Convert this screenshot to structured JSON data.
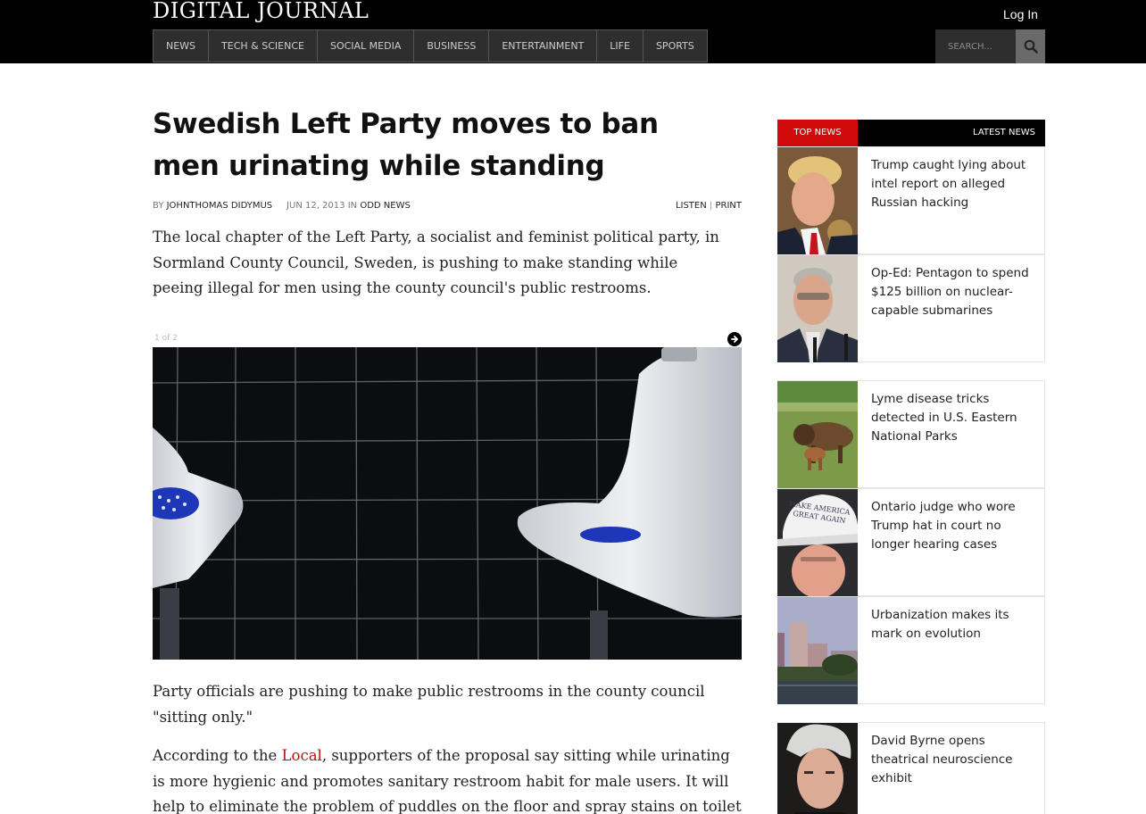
{
  "header": {
    "logo": "DIGITAL JOURNAL",
    "login": "Log In",
    "nav": [
      "NEWS",
      "TECH & SCIENCE",
      "SOCIAL MEDIA",
      "BUSINESS",
      "ENTERTAINMENT",
      "LIFE",
      "SPORTS"
    ],
    "search_placeholder": "SEARCH..."
  },
  "article": {
    "title": "Swedish Left Party moves to ban men urinating while standing",
    "by": "BY",
    "author": "JOHNTHOMAS DIDYMUS",
    "date": "JUN 12, 2013",
    "in": "IN",
    "category": "ODD NEWS",
    "listen": "LISTEN",
    "divider": "|",
    "print": "PRINT",
    "lead": "The local chapter of the Left Party, a socialist and feminist political party, in Sormland County Council, Sweden, is pushing to make standing while peeing illegal for men using the county council's public restrooms.",
    "gallery_counter": "1 of 2",
    "para2": "Party officials are pushing to make public restrooms in the county council \"sitting only.\"",
    "para3_pre": "According to the ",
    "para3_link": "Local",
    "para3_post": ", supporters of the proposal say sitting while urinating is more hygienic and promotes sanitary restroom habit for male users. It will help to eliminate the problem of puddles on the floor and spray stains on toilet seats. They"
  },
  "sidebar": {
    "tab_top": "TOP NEWS",
    "tab_latest": "LATEST NEWS",
    "items": [
      {
        "headline": "Trump caught lying about intel report on alleged Russian hacking"
      },
      {
        "headline": "Op-Ed: Pentagon to spend $125 billion on nuclear-capable submarines"
      },
      {
        "headline": "Lyme disease tricks detected in U.S. Eastern National Parks"
      },
      {
        "headline": "Ontario judge who wore Trump hat in court no longer hearing cases",
        "hat_text": "MAKE AMERICA GREAT AGAIN"
      },
      {
        "headline": "Urbanization makes its mark on evolution"
      },
      {
        "headline": "David Byrne opens theatrical neuroscience exhibit"
      }
    ]
  },
  "colors": {
    "header_bg": "#000000",
    "accent_red": "#d00a0a",
    "link_red": "#b3120f"
  }
}
